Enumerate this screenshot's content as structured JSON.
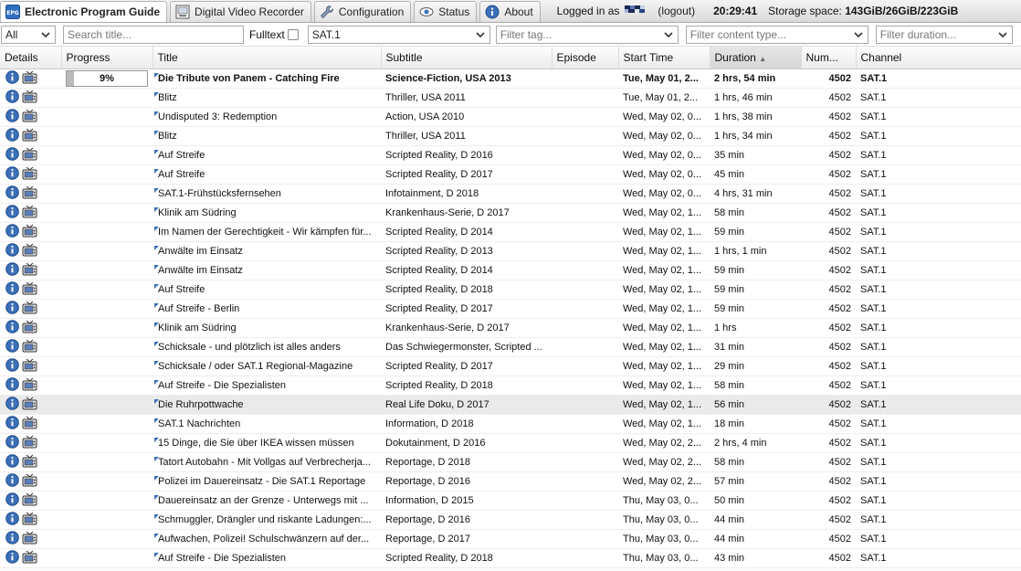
{
  "tabs": [
    {
      "label": "Electronic Program Guide",
      "icon": "epg-icon",
      "active": true
    },
    {
      "label": "Digital Video Recorder",
      "icon": "dvr-icon",
      "active": false
    },
    {
      "label": "Configuration",
      "icon": "wrench-icon",
      "active": false
    },
    {
      "label": "Status",
      "icon": "eye-icon",
      "active": false
    },
    {
      "label": "About",
      "icon": "info-icon",
      "active": false
    }
  ],
  "header": {
    "logged_in_label": "Logged in as",
    "logout_label": "(logout)",
    "clock": "20:29:41",
    "storage_label": "Storage space:",
    "storage_value": "143GiB/26GiB/223GiB"
  },
  "filters": {
    "scope_value": "All",
    "search_placeholder": "Search title...",
    "fulltext_label": "Fulltext",
    "channel_value": "SAT.1",
    "tag_placeholder": "Filter tag...",
    "content_type_placeholder": "Filter content type...",
    "duration_placeholder": "Filter duration..."
  },
  "columns": [
    "Details",
    "Progress",
    "Title",
    "Subtitle",
    "Episode",
    "Start Time",
    "Duration",
    "Num...",
    "Channel"
  ],
  "sort_indicator": "▲",
  "colors": {
    "accent": "#3b6fb6",
    "progress_fill": "#b9b9b9",
    "highlight": "#eaeaea"
  },
  "rows": [
    {
      "progress": "9%",
      "progress_value": 0.09,
      "title": "Die Tribute von Panem - Catching Fire",
      "subtitle": "Science-Fiction, USA 2013",
      "episode": "",
      "start": "Tue, May 01, 2...",
      "duration": "2 hrs, 54 min",
      "num": "4502",
      "channel": "SAT.1",
      "bold": true
    },
    {
      "progress": "",
      "title": "Blitz",
      "subtitle": "Thriller, USA 2011",
      "episode": "",
      "start": "Tue, May 01, 2...",
      "duration": "1 hrs, 46 min",
      "num": "4502",
      "channel": "SAT.1"
    },
    {
      "progress": "",
      "title": "Undisputed 3: Redemption",
      "subtitle": "Action, USA 2010",
      "episode": "",
      "start": "Wed, May 02, 0...",
      "duration": "1 hrs, 38 min",
      "num": "4502",
      "channel": "SAT.1"
    },
    {
      "progress": "",
      "title": "Blitz",
      "subtitle": "Thriller, USA 2011",
      "episode": "",
      "start": "Wed, May 02, 0...",
      "duration": "1 hrs, 34 min",
      "num": "4502",
      "channel": "SAT.1"
    },
    {
      "progress": "",
      "title": "Auf Streife",
      "subtitle": "Scripted Reality, D 2016",
      "episode": "",
      "start": "Wed, May 02, 0...",
      "duration": "35 min",
      "num": "4502",
      "channel": "SAT.1"
    },
    {
      "progress": "",
      "title": "Auf Streife",
      "subtitle": "Scripted Reality, D 2017",
      "episode": "",
      "start": "Wed, May 02, 0...",
      "duration": "45 min",
      "num": "4502",
      "channel": "SAT.1"
    },
    {
      "progress": "",
      "title": "SAT.1-Frühstücksfernsehen",
      "subtitle": "Infotainment, D 2018",
      "episode": "",
      "start": "Wed, May 02, 0...",
      "duration": "4 hrs, 31 min",
      "num": "4502",
      "channel": "SAT.1"
    },
    {
      "progress": "",
      "title": "Klinik am Südring",
      "subtitle": "Krankenhaus-Serie, D 2017",
      "episode": "",
      "start": "Wed, May 02, 1...",
      "duration": "58 min",
      "num": "4502",
      "channel": "SAT.1"
    },
    {
      "progress": "",
      "title": "Im Namen der Gerechtigkeit - Wir kämpfen für...",
      "subtitle": "Scripted Reality, D 2014",
      "episode": "",
      "start": "Wed, May 02, 1...",
      "duration": "59 min",
      "num": "4502",
      "channel": "SAT.1"
    },
    {
      "progress": "",
      "title": "Anwälte im Einsatz",
      "subtitle": "Scripted Reality, D 2013",
      "episode": "",
      "start": "Wed, May 02, 1...",
      "duration": "1 hrs, 1 min",
      "num": "4502",
      "channel": "SAT.1"
    },
    {
      "progress": "",
      "title": "Anwälte im Einsatz",
      "subtitle": "Scripted Reality, D 2014",
      "episode": "",
      "start": "Wed, May 02, 1...",
      "duration": "59 min",
      "num": "4502",
      "channel": "SAT.1"
    },
    {
      "progress": "",
      "title": "Auf Streife",
      "subtitle": "Scripted Reality, D 2018",
      "episode": "",
      "start": "Wed, May 02, 1...",
      "duration": "59 min",
      "num": "4502",
      "channel": "SAT.1"
    },
    {
      "progress": "",
      "title": "Auf Streife - Berlin",
      "subtitle": "Scripted Reality, D 2017",
      "episode": "",
      "start": "Wed, May 02, 1...",
      "duration": "59 min",
      "num": "4502",
      "channel": "SAT.1"
    },
    {
      "progress": "",
      "title": "Klinik am Südring",
      "subtitle": "Krankenhaus-Serie, D 2017",
      "episode": "",
      "start": "Wed, May 02, 1...",
      "duration": "1 hrs",
      "num": "4502",
      "channel": "SAT.1"
    },
    {
      "progress": "",
      "title": "Schicksale - und plötzlich ist alles anders",
      "subtitle": "Das Schwiegermonster, Scripted ...",
      "episode": "",
      "start": "Wed, May 02, 1...",
      "duration": "31 min",
      "num": "4502",
      "channel": "SAT.1"
    },
    {
      "progress": "",
      "title": "Schicksale / oder SAT.1 Regional-Magazine",
      "subtitle": "Scripted Reality, D 2017",
      "episode": "",
      "start": "Wed, May 02, 1...",
      "duration": "29 min",
      "num": "4502",
      "channel": "SAT.1"
    },
    {
      "progress": "",
      "title": "Auf Streife - Die Spezialisten",
      "subtitle": "Scripted Reality, D 2018",
      "episode": "",
      "start": "Wed, May 02, 1...",
      "duration": "58 min",
      "num": "4502",
      "channel": "SAT.1"
    },
    {
      "progress": "",
      "title": "Die Ruhrpottwache",
      "subtitle": "Real Life Doku, D 2017",
      "episode": "",
      "start": "Wed, May 02, 1...",
      "duration": "56 min",
      "num": "4502",
      "channel": "SAT.1",
      "highlight": true
    },
    {
      "progress": "",
      "title": "SAT.1 Nachrichten",
      "subtitle": "Information, D 2018",
      "episode": "",
      "start": "Wed, May 02, 1...",
      "duration": "18 min",
      "num": "4502",
      "channel": "SAT.1"
    },
    {
      "progress": "",
      "title": "15 Dinge, die Sie über IKEA wissen müssen",
      "subtitle": "Dokutainment, D 2016",
      "episode": "",
      "start": "Wed, May 02, 2...",
      "duration": "2 hrs, 4 min",
      "num": "4502",
      "channel": "SAT.1"
    },
    {
      "progress": "",
      "title": "Tatort Autobahn - Mit Vollgas auf Verbrecherja...",
      "subtitle": "Reportage, D 2018",
      "episode": "",
      "start": "Wed, May 02, 2...",
      "duration": "58 min",
      "num": "4502",
      "channel": "SAT.1"
    },
    {
      "progress": "",
      "title": "Polizei im Dauereinsatz - Die SAT.1 Reportage",
      "subtitle": "Reportage, D 2016",
      "episode": "",
      "start": "Wed, May 02, 2...",
      "duration": "57 min",
      "num": "4502",
      "channel": "SAT.1"
    },
    {
      "progress": "",
      "title": "Dauereinsatz an der Grenze - Unterwegs mit ...",
      "subtitle": "Information, D 2015",
      "episode": "",
      "start": "Thu, May 03, 0...",
      "duration": "50 min",
      "num": "4502",
      "channel": "SAT.1"
    },
    {
      "progress": "",
      "title": "Schmuggler, Drängler und riskante Ladungen:...",
      "subtitle": "Reportage, D 2016",
      "episode": "",
      "start": "Thu, May 03, 0...",
      "duration": "44 min",
      "num": "4502",
      "channel": "SAT.1"
    },
    {
      "progress": "",
      "title": "Aufwachen, Polizei! Schulschwänzern auf der...",
      "subtitle": "Reportage, D 2017",
      "episode": "",
      "start": "Thu, May 03, 0...",
      "duration": "44 min",
      "num": "4502",
      "channel": "SAT.1"
    },
    {
      "progress": "",
      "title": "Auf Streife - Die Spezialisten",
      "subtitle": "Scripted Reality, D 2018",
      "episode": "",
      "start": "Thu, May 03, 0...",
      "duration": "43 min",
      "num": "4502",
      "channel": "SAT.1"
    }
  ]
}
